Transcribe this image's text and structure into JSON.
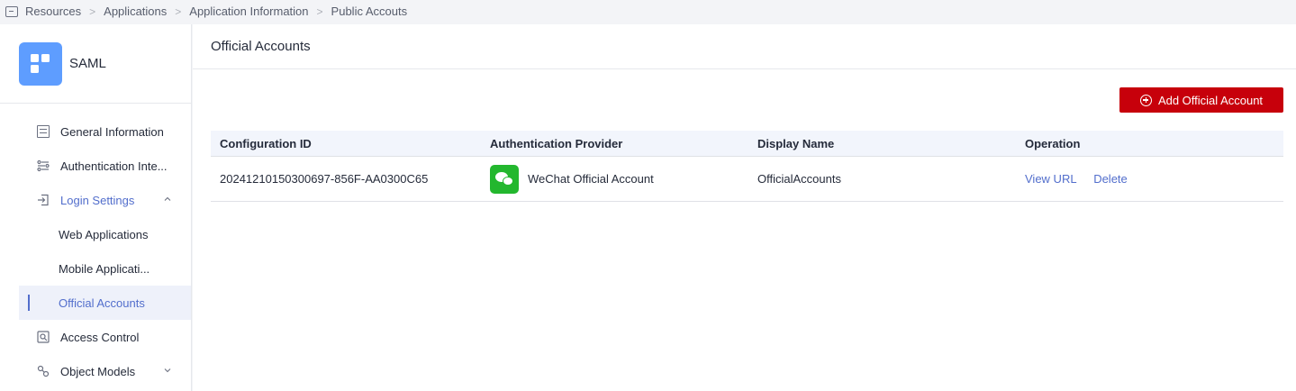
{
  "breadcrumb": {
    "icon": "resources-icon",
    "items": [
      "Resources",
      "Applications",
      "Application Information",
      "Public Accouts"
    ]
  },
  "app": {
    "name": "SAML",
    "logo_color": "#5e9dff"
  },
  "sidebar": {
    "items": [
      {
        "label": "General Information",
        "icon": "document-icon"
      },
      {
        "label": "Authentication Inte...",
        "icon": "authentication-icon"
      },
      {
        "label": "Login Settings",
        "icon": "login-icon",
        "expanded": true
      },
      {
        "label": "Web Applications"
      },
      {
        "label": "Mobile Applicati..."
      },
      {
        "label": "Official Accounts",
        "active": true
      },
      {
        "label": "Access Control",
        "icon": "access-control-icon"
      },
      {
        "label": "Object Models",
        "icon": "object-models-icon",
        "expanded": false
      }
    ]
  },
  "main": {
    "title": "Official Accounts",
    "add_button": "Add Official Account",
    "table": {
      "headers": [
        "Configuration ID",
        "Authentication Provider",
        "Display Name",
        "Operation"
      ],
      "rows": [
        {
          "config_id": "20241210150300697-856F-AA0300C65",
          "provider": "WeChat Official Account",
          "provider_icon": "wechat-icon",
          "display_name": "OfficialAccounts",
          "actions": [
            "View URL",
            "Delete"
          ]
        }
      ]
    }
  },
  "colors": {
    "accent": "#526ecc",
    "primary_button": "#c7000b",
    "wechat": "#23b72e"
  }
}
